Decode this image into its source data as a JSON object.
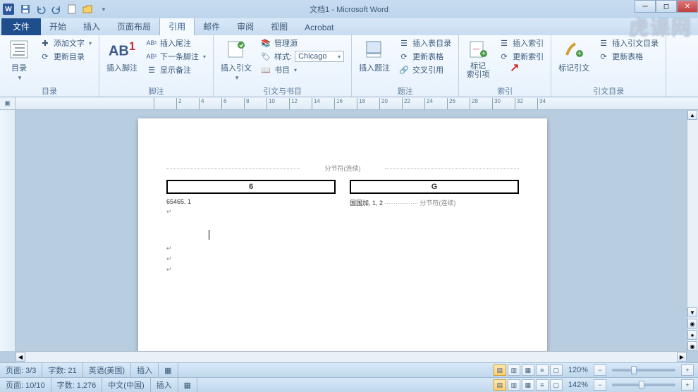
{
  "title": "文档1 - Microsoft Word",
  "qat": {
    "save": "保存",
    "undo": "撤销",
    "redo": "重做"
  },
  "tabs": {
    "file": "文件",
    "items": [
      "开始",
      "插入",
      "页面布局",
      "引用",
      "邮件",
      "审阅",
      "视图",
      "Acrobat"
    ],
    "active_index": 3
  },
  "ribbon": {
    "toc": {
      "label": "目录",
      "main": "目录",
      "add_text": "添加文字",
      "update": "更新目录"
    },
    "footnotes": {
      "label": "脚注",
      "main": "插入脚注",
      "endnote": "插入尾注",
      "next": "下一条脚注",
      "show": "显示备注"
    },
    "citations": {
      "label": "引文与书目",
      "main": "插入引文",
      "manage": "管理源",
      "style_lbl": "样式:",
      "style_val": "Chicago",
      "biblio": "书目"
    },
    "captions": {
      "label": "题注",
      "main": "插入题注",
      "figures": "插入表目录",
      "update": "更新表格",
      "xref": "交叉引用"
    },
    "index": {
      "label": "索引",
      "mark": "标记\n索引项",
      "insert": "插入索引",
      "update": "更新索引"
    },
    "toa": {
      "label": "引文目录",
      "mark": "标记引文",
      "insert": "插入引文目录",
      "update": "更新表格"
    }
  },
  "document": {
    "section_break": "分节符(连续)",
    "col1_head": "6",
    "col1_entry": "65465, 1",
    "col2_head": "G",
    "col2_entry": "国国加, 1, 2",
    "col2_break": "分节符(连续)"
  },
  "status1": {
    "page": "页面: 3/3",
    "words": "字数: 21",
    "lang": "英语(美国)",
    "mode": "插入",
    "zoom": "120%"
  },
  "status2": {
    "page": "页面: 10/10",
    "words": "字数: 1,276",
    "lang": "中文(中国)",
    "mode": "插入",
    "zoom": "142%"
  },
  "watermark": "虎课网"
}
